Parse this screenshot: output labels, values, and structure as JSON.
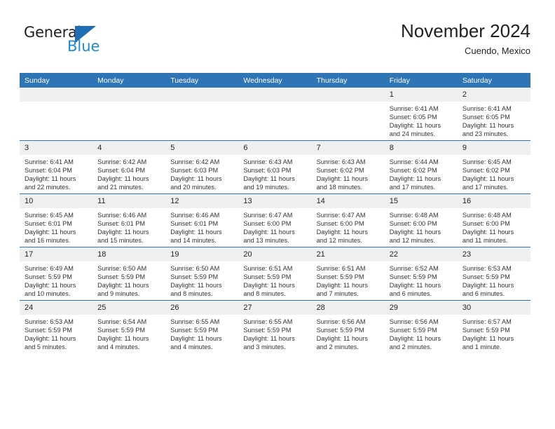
{
  "brand": {
    "name_part1": "General",
    "name_part2": "Blue",
    "mark": "triangle-flag-icon",
    "accent_color": "#1f8ad4"
  },
  "header": {
    "title": "November 2024",
    "subtitle": "Cuendo, Mexico"
  },
  "calendar": {
    "header_color": "#2f74b5",
    "daynum_band_color": "#efefef",
    "weekday_labels": [
      "Sunday",
      "Monday",
      "Tuesday",
      "Wednesday",
      "Thursday",
      "Friday",
      "Saturday"
    ],
    "weeks": [
      [
        {
          "day": "",
          "lines": []
        },
        {
          "day": "",
          "lines": []
        },
        {
          "day": "",
          "lines": []
        },
        {
          "day": "",
          "lines": []
        },
        {
          "day": "",
          "lines": []
        },
        {
          "day": "1",
          "lines": [
            "Sunrise: 6:41 AM",
            "Sunset: 6:05 PM",
            "Daylight: 11 hours",
            "and 24 minutes."
          ]
        },
        {
          "day": "2",
          "lines": [
            "Sunrise: 6:41 AM",
            "Sunset: 6:05 PM",
            "Daylight: 11 hours",
            "and 23 minutes."
          ]
        }
      ],
      [
        {
          "day": "3",
          "lines": [
            "Sunrise: 6:41 AM",
            "Sunset: 6:04 PM",
            "Daylight: 11 hours",
            "and 22 minutes."
          ]
        },
        {
          "day": "4",
          "lines": [
            "Sunrise: 6:42 AM",
            "Sunset: 6:04 PM",
            "Daylight: 11 hours",
            "and 21 minutes."
          ]
        },
        {
          "day": "5",
          "lines": [
            "Sunrise: 6:42 AM",
            "Sunset: 6:03 PM",
            "Daylight: 11 hours",
            "and 20 minutes."
          ]
        },
        {
          "day": "6",
          "lines": [
            "Sunrise: 6:43 AM",
            "Sunset: 6:03 PM",
            "Daylight: 11 hours",
            "and 19 minutes."
          ]
        },
        {
          "day": "7",
          "lines": [
            "Sunrise: 6:43 AM",
            "Sunset: 6:02 PM",
            "Daylight: 11 hours",
            "and 18 minutes."
          ]
        },
        {
          "day": "8",
          "lines": [
            "Sunrise: 6:44 AM",
            "Sunset: 6:02 PM",
            "Daylight: 11 hours",
            "and 17 minutes."
          ]
        },
        {
          "day": "9",
          "lines": [
            "Sunrise: 6:45 AM",
            "Sunset: 6:02 PM",
            "Daylight: 11 hours",
            "and 17 minutes."
          ]
        }
      ],
      [
        {
          "day": "10",
          "lines": [
            "Sunrise: 6:45 AM",
            "Sunset: 6:01 PM",
            "Daylight: 11 hours",
            "and 16 minutes."
          ]
        },
        {
          "day": "11",
          "lines": [
            "Sunrise: 6:46 AM",
            "Sunset: 6:01 PM",
            "Daylight: 11 hours",
            "and 15 minutes."
          ]
        },
        {
          "day": "12",
          "lines": [
            "Sunrise: 6:46 AM",
            "Sunset: 6:01 PM",
            "Daylight: 11 hours",
            "and 14 minutes."
          ]
        },
        {
          "day": "13",
          "lines": [
            "Sunrise: 6:47 AM",
            "Sunset: 6:00 PM",
            "Daylight: 11 hours",
            "and 13 minutes."
          ]
        },
        {
          "day": "14",
          "lines": [
            "Sunrise: 6:47 AM",
            "Sunset: 6:00 PM",
            "Daylight: 11 hours",
            "and 12 minutes."
          ]
        },
        {
          "day": "15",
          "lines": [
            "Sunrise: 6:48 AM",
            "Sunset: 6:00 PM",
            "Daylight: 11 hours",
            "and 12 minutes."
          ]
        },
        {
          "day": "16",
          "lines": [
            "Sunrise: 6:48 AM",
            "Sunset: 6:00 PM",
            "Daylight: 11 hours",
            "and 11 minutes."
          ]
        }
      ],
      [
        {
          "day": "17",
          "lines": [
            "Sunrise: 6:49 AM",
            "Sunset: 5:59 PM",
            "Daylight: 11 hours",
            "and 10 minutes."
          ]
        },
        {
          "day": "18",
          "lines": [
            "Sunrise: 6:50 AM",
            "Sunset: 5:59 PM",
            "Daylight: 11 hours",
            "and 9 minutes."
          ]
        },
        {
          "day": "19",
          "lines": [
            "Sunrise: 6:50 AM",
            "Sunset: 5:59 PM",
            "Daylight: 11 hours",
            "and 8 minutes."
          ]
        },
        {
          "day": "20",
          "lines": [
            "Sunrise: 6:51 AM",
            "Sunset: 5:59 PM",
            "Daylight: 11 hours",
            "and 8 minutes."
          ]
        },
        {
          "day": "21",
          "lines": [
            "Sunrise: 6:51 AM",
            "Sunset: 5:59 PM",
            "Daylight: 11 hours",
            "and 7 minutes."
          ]
        },
        {
          "day": "22",
          "lines": [
            "Sunrise: 6:52 AM",
            "Sunset: 5:59 PM",
            "Daylight: 11 hours",
            "and 6 minutes."
          ]
        },
        {
          "day": "23",
          "lines": [
            "Sunrise: 6:53 AM",
            "Sunset: 5:59 PM",
            "Daylight: 11 hours",
            "and 6 minutes."
          ]
        }
      ],
      [
        {
          "day": "24",
          "lines": [
            "Sunrise: 6:53 AM",
            "Sunset: 5:59 PM",
            "Daylight: 11 hours",
            "and 5 minutes."
          ]
        },
        {
          "day": "25",
          "lines": [
            "Sunrise: 6:54 AM",
            "Sunset: 5:59 PM",
            "Daylight: 11 hours",
            "and 4 minutes."
          ]
        },
        {
          "day": "26",
          "lines": [
            "Sunrise: 6:55 AM",
            "Sunset: 5:59 PM",
            "Daylight: 11 hours",
            "and 4 minutes."
          ]
        },
        {
          "day": "27",
          "lines": [
            "Sunrise: 6:55 AM",
            "Sunset: 5:59 PM",
            "Daylight: 11 hours",
            "and 3 minutes."
          ]
        },
        {
          "day": "28",
          "lines": [
            "Sunrise: 6:56 AM",
            "Sunset: 5:59 PM",
            "Daylight: 11 hours",
            "and 2 minutes."
          ]
        },
        {
          "day": "29",
          "lines": [
            "Sunrise: 6:56 AM",
            "Sunset: 5:59 PM",
            "Daylight: 11 hours",
            "and 2 minutes."
          ]
        },
        {
          "day": "30",
          "lines": [
            "Sunrise: 6:57 AM",
            "Sunset: 5:59 PM",
            "Daylight: 11 hours",
            "and 1 minute."
          ]
        }
      ]
    ]
  }
}
